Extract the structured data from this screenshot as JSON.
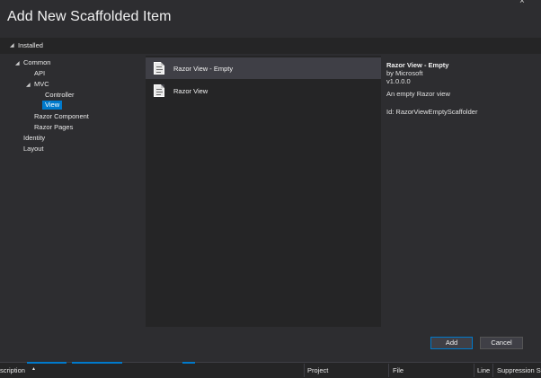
{
  "dialog": {
    "title": "Add New Scaffolded Item",
    "close_glyph": "×"
  },
  "installed": {
    "label": "Installed",
    "arrow_glyph": "◢"
  },
  "tree": {
    "common": "Common",
    "api": "API",
    "mvc": "MVC",
    "controller": "Controller",
    "view": "View",
    "razor_component": "Razor Component",
    "razor_pages": "Razor Pages",
    "identity": "Identity",
    "layout": "Layout",
    "arrow_glyph": "◢"
  },
  "list": {
    "items": [
      {
        "label": "Razor View - Empty",
        "icon": "razor-file-icon",
        "selected": true
      },
      {
        "label": "Razor View",
        "icon": "razor-file-icon",
        "selected": false
      }
    ]
  },
  "details": {
    "title": "Razor View - Empty",
    "author": "by Microsoft",
    "version": "v1.0.0.0",
    "description": "An empty Razor view",
    "id": "Id: RazorViewEmptyScaffolder"
  },
  "buttons": {
    "add": "Add",
    "cancel": "Cancel"
  },
  "bottom_bar": {
    "description": "scription",
    "sort_glyph": "▲",
    "project": "Project",
    "file": "File",
    "line": "Line",
    "suppression": "Suppression St"
  },
  "colors": {
    "accent": "#007acc",
    "background": "#2d2d30",
    "panel": "#252526",
    "selected_row": "#3f3f46"
  }
}
